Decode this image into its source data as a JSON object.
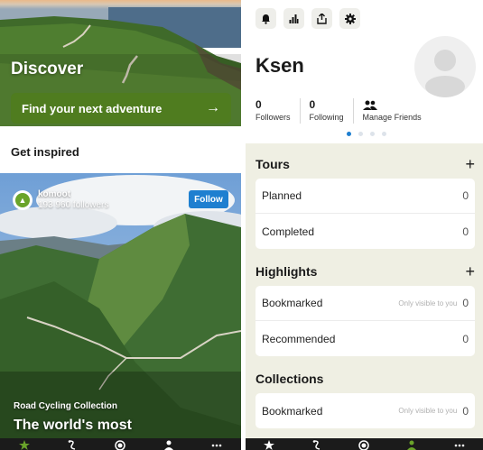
{
  "discover": {
    "title": "Discover",
    "cta_label": "Find your next adventure",
    "get_inspired": "Get inspired",
    "card": {
      "publisher_name": "komoot",
      "publisher_followers": "193 960 followers",
      "follow_label": "Follow",
      "category": "Road Cycling Collection",
      "title": "The world's most"
    }
  },
  "tabbar": {
    "items": [
      "star-icon",
      "route-icon",
      "record-icon",
      "profile-icon",
      "more-icon"
    ],
    "active_color": "#6aa42a"
  },
  "profile": {
    "name": "Ksen",
    "stats": [
      {
        "value": "0",
        "label": "Followers"
      },
      {
        "value": "0",
        "label": "Following"
      }
    ],
    "manage_friends": "Manage Friends",
    "pager": {
      "count": 4,
      "active_index": 0
    },
    "sections": {
      "tours": {
        "title": "Tours",
        "rows": [
          {
            "label": "Planned",
            "hint": "",
            "count": "0"
          },
          {
            "label": "Completed",
            "hint": "",
            "count": "0"
          }
        ]
      },
      "highlights": {
        "title": "Highlights",
        "rows": [
          {
            "label": "Bookmarked",
            "hint": "Only visible to you",
            "count": "0"
          },
          {
            "label": "Recommended",
            "hint": "",
            "count": "0"
          }
        ]
      },
      "collections": {
        "title": "Collections",
        "rows": [
          {
            "label": "Bookmarked",
            "hint": "Only visible to you",
            "count": "0"
          }
        ]
      }
    }
  },
  "colors": {
    "brand_green": "#4f7c1f",
    "follow_blue": "#1e7fd0",
    "section_bg": "#efefe3"
  }
}
